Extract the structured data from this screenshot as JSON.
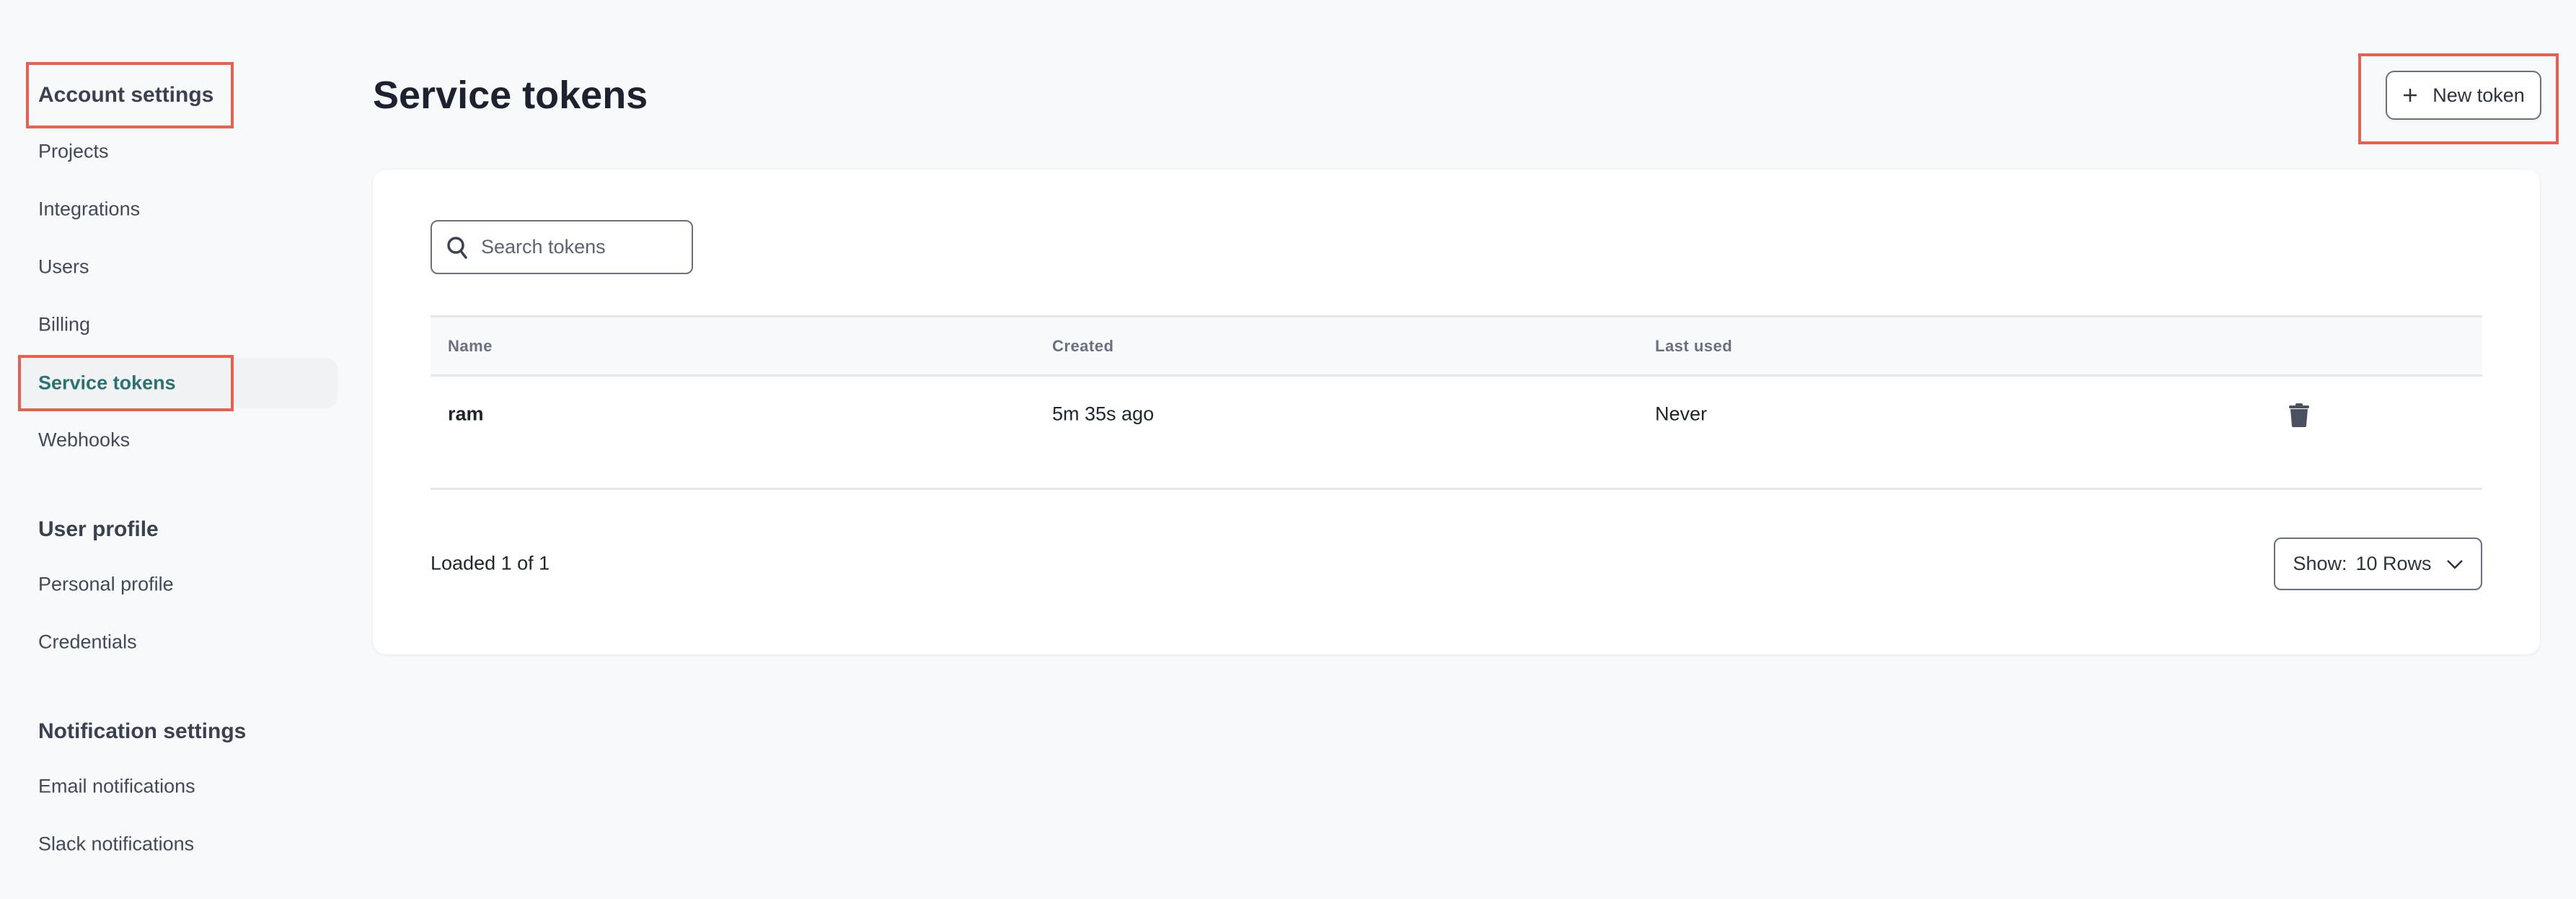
{
  "sidebar": {
    "sections": [
      {
        "heading": "Account settings",
        "items": [
          "Projects",
          "Integrations",
          "Users",
          "Billing",
          "Service tokens",
          "Webhooks"
        ]
      },
      {
        "heading": "User profile",
        "items": [
          "Personal profile",
          "Credentials"
        ]
      },
      {
        "heading": "Notification settings",
        "items": [
          "Email notifications",
          "Slack notifications"
        ]
      }
    ],
    "active_item": "Service tokens"
  },
  "page": {
    "title": "Service tokens",
    "new_button_label": "New token",
    "new_button_icon": "plus-icon"
  },
  "search": {
    "placeholder": "Search tokens",
    "value": "",
    "icon": "search-icon"
  },
  "table": {
    "columns": [
      "Name",
      "Created",
      "Last used"
    ],
    "rows": [
      {
        "name": "ram",
        "created": "5m 35s ago",
        "last_used": "Never",
        "action_icon": "trash-icon"
      }
    ]
  },
  "footer": {
    "loaded_text": "Loaded 1 of 1",
    "show_label": "Show:",
    "rows_value": "10 Rows"
  },
  "colors": {
    "accent": "#2a7372",
    "annotation": "#e8604e",
    "background": "#f8f9fb"
  }
}
